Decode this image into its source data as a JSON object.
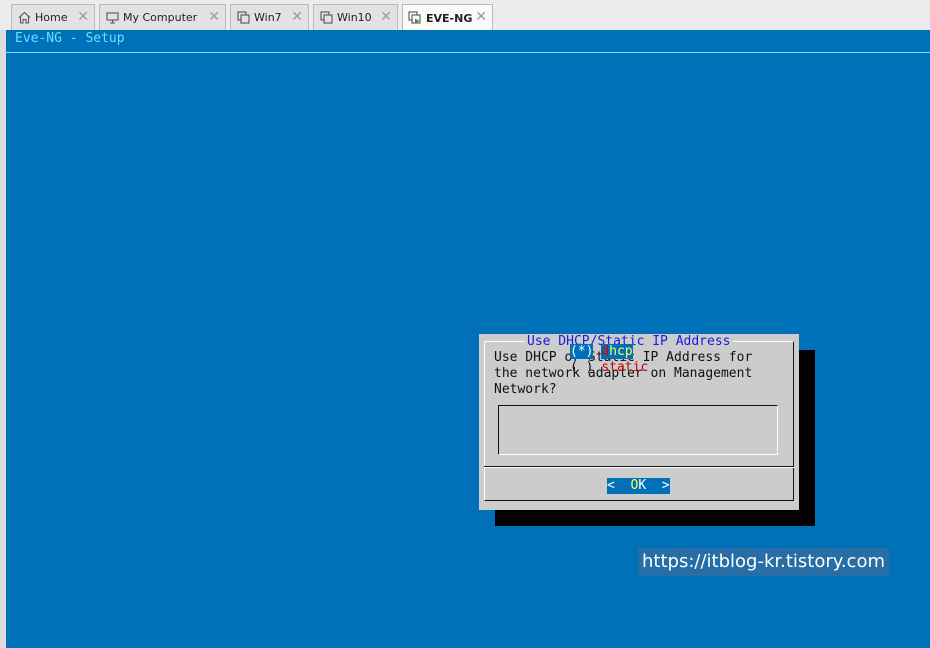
{
  "tabs": [
    {
      "label": "Home",
      "icon": "home-icon",
      "active": false
    },
    {
      "label": "My Computer",
      "icon": "computer-icon",
      "active": false
    },
    {
      "label": "Win7",
      "icon": "vm-icon",
      "active": false
    },
    {
      "label": "Win10",
      "icon": "vm-icon",
      "active": false
    },
    {
      "label": "EVE-NG",
      "icon": "vm-running-icon",
      "active": true
    }
  ],
  "console": {
    "title": "Eve-NG - Setup",
    "bg_color": "#0070b8",
    "accent_color": "#5fe7ff"
  },
  "dialog": {
    "title": "Use DHCP/Static IP Address",
    "prompt_lines": [
      "Use DHCP or Static IP Address for",
      "the network adapter on Management",
      "Network?"
    ],
    "options": [
      {
        "mark": "(*)",
        "hotkey": "d",
        "rest": "hcp",
        "selected": true
      },
      {
        "mark": "( )",
        "hotkey": "",
        "rest": "static",
        "selected": false
      }
    ],
    "ok_left": "<  ",
    "ok_hotkey": "O",
    "ok_rest": "K  >"
  },
  "watermark": "https://itblog-kr.tistory.com"
}
